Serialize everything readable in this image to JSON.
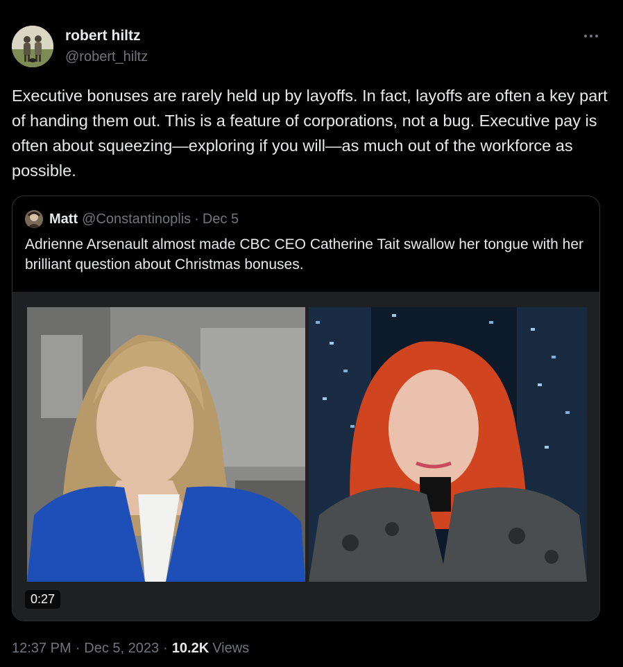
{
  "author": {
    "display_name": "robert hiltz",
    "handle": "@robert_hiltz",
    "avatar_icon": "avatar-two-people-with-dog"
  },
  "more_icon": "more-horizontal-icon",
  "tweet_text": "Executive bonuses are rarely held up by layoffs. In fact, layoffs are often a key part of handing them out. This is a feature of corporations, not a bug. Executive pay is often about squeezing—exploring if you will—as much out of the workforce as possible.",
  "quoted": {
    "display_name": "Matt",
    "handle": "@Constantinoplis",
    "separator": "·",
    "date": "Dec 5",
    "text": "Adrienne Arsenault almost made CBC CEO Catherine Tait swallow her tongue with her brilliant question about Christmas bonuses.",
    "video_duration": "0:27"
  },
  "meta": {
    "time": "12:37 PM",
    "separator": "·",
    "date": "Dec 5, 2023",
    "views_count": "10.2K",
    "views_label": "Views"
  },
  "colors": {
    "background": "#000000",
    "text": "#e7e9ea",
    "secondary": "#71767b",
    "border": "#2f3336"
  }
}
